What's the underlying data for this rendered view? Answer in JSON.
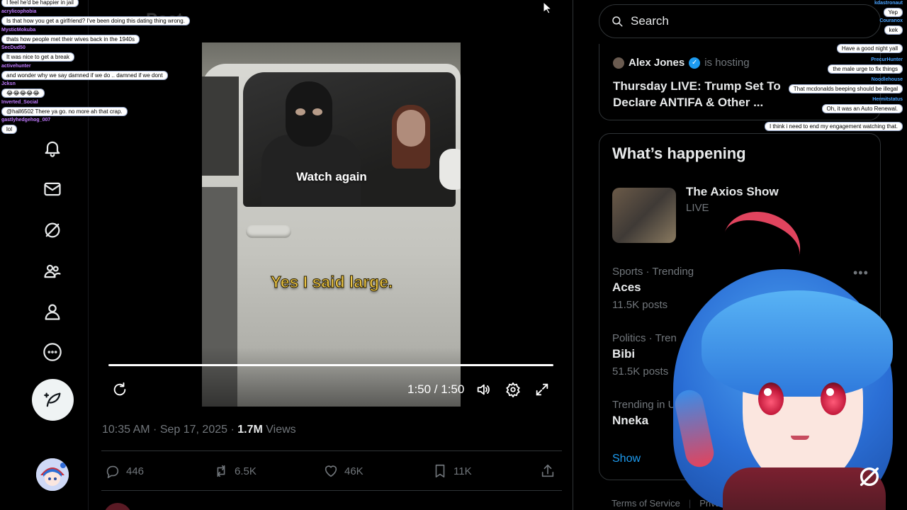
{
  "header": {
    "title_partial": "Post"
  },
  "video": {
    "watch_again": "Watch again",
    "caption": "Yes I said large.",
    "time": "1:50 / 1:50",
    "progress": 1.0
  },
  "post": {
    "time": "10:35 AM · Sep 17, 2025",
    "separator": " · ",
    "views_count": "1.7M",
    "views_label": " Views",
    "actions": {
      "replies": "446",
      "reposts": "6.5K",
      "likes": "46K",
      "bookmarks": "11K"
    }
  },
  "search": {
    "placeholder": "Search"
  },
  "space": {
    "host": "Alex Jones",
    "host_label": "is hosting",
    "title": "Thursday LIVE: Trump Set To Declare ANTIFA & Other ..."
  },
  "happening": {
    "title": "What’s happening",
    "live_item": {
      "title": "The Axios Show",
      "status": "LIVE"
    },
    "trends": [
      {
        "category": "Sports · Trending",
        "name": "Aces",
        "count": "11.5K posts"
      },
      {
        "category": "Politics · Tren",
        "name": "Bibi",
        "count": "51.5K posts"
      },
      {
        "category": "Trending in Un",
        "name": "Nneka",
        "count": ""
      }
    ],
    "show_more": "Show"
  },
  "footer": {
    "terms": "Terms of Service",
    "privacy": "Privac"
  },
  "chat_left": [
    {
      "user": "",
      "text": "I feel he'd be happier in jail"
    },
    {
      "user": "acrylicophobia",
      "text": "Is that how you get a girlfriend? I've been doing this dating thing wrong."
    },
    {
      "user": "MysticMokuba",
      "text": "thats how people met their wives back in the 1940s"
    },
    {
      "user": "SecDud50",
      "text": "It was nice to get a break"
    },
    {
      "user": "activehunter",
      "text": "and wonder why we say damned if we do .. damned if we dont"
    },
    {
      "user": "Jcksn",
      "text": "😂😂😂😂😂"
    },
    {
      "user": "Inverted_Social",
      "text": "@hall6502 There ya go. no more ah that crap."
    },
    {
      "user": "gastlyhedgehog_007",
      "text": "lol"
    }
  ],
  "chat_right": [
    {
      "user": "kdastronaut",
      "text": "Yep"
    },
    {
      "user": "Couranox",
      "text": "kek"
    },
    {
      "user": "",
      "text": "Have a good night yall"
    },
    {
      "user": "PrecurHunter",
      "text": "the male urge to fix things"
    },
    {
      "user": "Noodlehouse",
      "text": "That mcdonalds beeping should be illegal"
    },
    {
      "user": "Hermitstatus",
      "text": "Oh, it was an Auto Renewal."
    },
    {
      "user": "",
      "text": "I think i need to end my engagement watching that."
    }
  ],
  "colors": {
    "accent": "#1d9bf0",
    "caption": "#e8c244",
    "muted": "#71767b"
  },
  "icons": [
    "notifications-icon",
    "messages-icon",
    "grok-icon",
    "communities-icon",
    "profile-icon",
    "more-icon",
    "post-feather-icon",
    "replay-icon",
    "volume-icon",
    "settings-icon",
    "fullscreen-icon",
    "reply-icon",
    "repost-icon",
    "like-icon",
    "bookmark-icon",
    "share-icon",
    "search-icon",
    "verified-icon"
  ]
}
